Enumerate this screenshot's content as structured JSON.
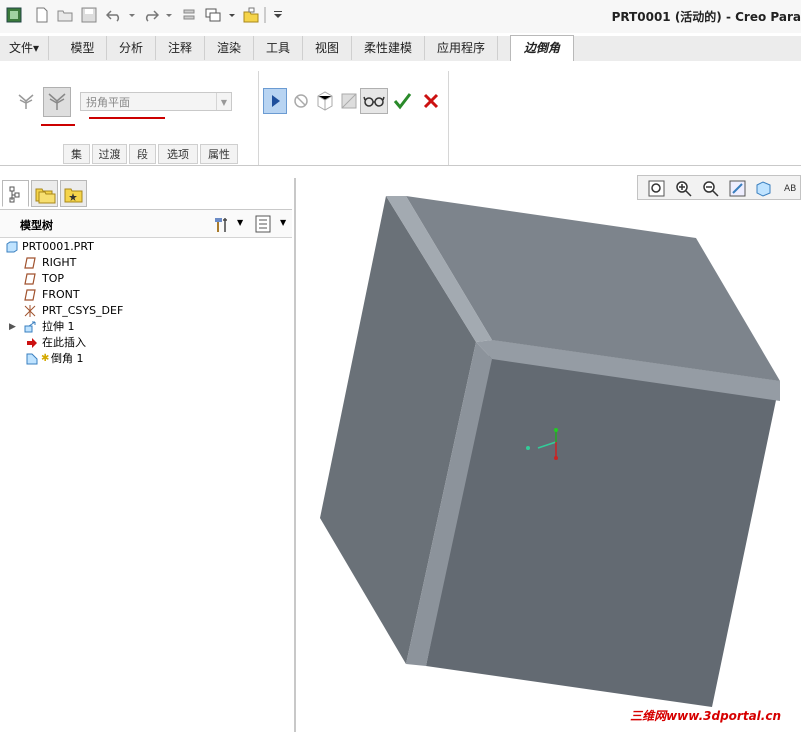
{
  "window": {
    "title": "PRT0001 (活动的) - Creo Para"
  },
  "quick_access": [
    "new-icon",
    "open-icon",
    "save-icon",
    "undo-icon",
    "redo-icon",
    "regenerate-icon",
    "windows-icon",
    "close-window-icon"
  ],
  "tabs": [
    {
      "label": "文件▾"
    },
    {
      "label": "模型"
    },
    {
      "label": "分析"
    },
    {
      "label": "注释"
    },
    {
      "label": "渲染"
    },
    {
      "label": "工具"
    },
    {
      "label": "视图"
    },
    {
      "label": "柔性建模"
    },
    {
      "label": "应用程序"
    },
    {
      "label": "边倒角"
    }
  ],
  "ribbon": {
    "combo_value": "拐角平面",
    "subtabs": [
      "集",
      "过渡",
      "段",
      "选项",
      "属性"
    ]
  },
  "left_panel": {
    "tree_title": "模型树",
    "items": [
      {
        "label": "PRT0001.PRT"
      },
      {
        "label": "RIGHT"
      },
      {
        "label": "TOP"
      },
      {
        "label": "FRONT"
      },
      {
        "label": "PRT_CSYS_DEF"
      },
      {
        "label": "拉伸 1"
      },
      {
        "label": "在此插入"
      },
      {
        "label": "倒角 1"
      }
    ]
  },
  "watermark": "三维网www.3dportal.cn",
  "colors": {
    "cube_top": "#7d848c",
    "cube_left": "#6a7178",
    "cube_front": "#636a72",
    "chamfer": "#9aa1a8",
    "accept": "#2a8a2a",
    "cancel": "#cc1111",
    "annotation_red": "#cc0000"
  }
}
